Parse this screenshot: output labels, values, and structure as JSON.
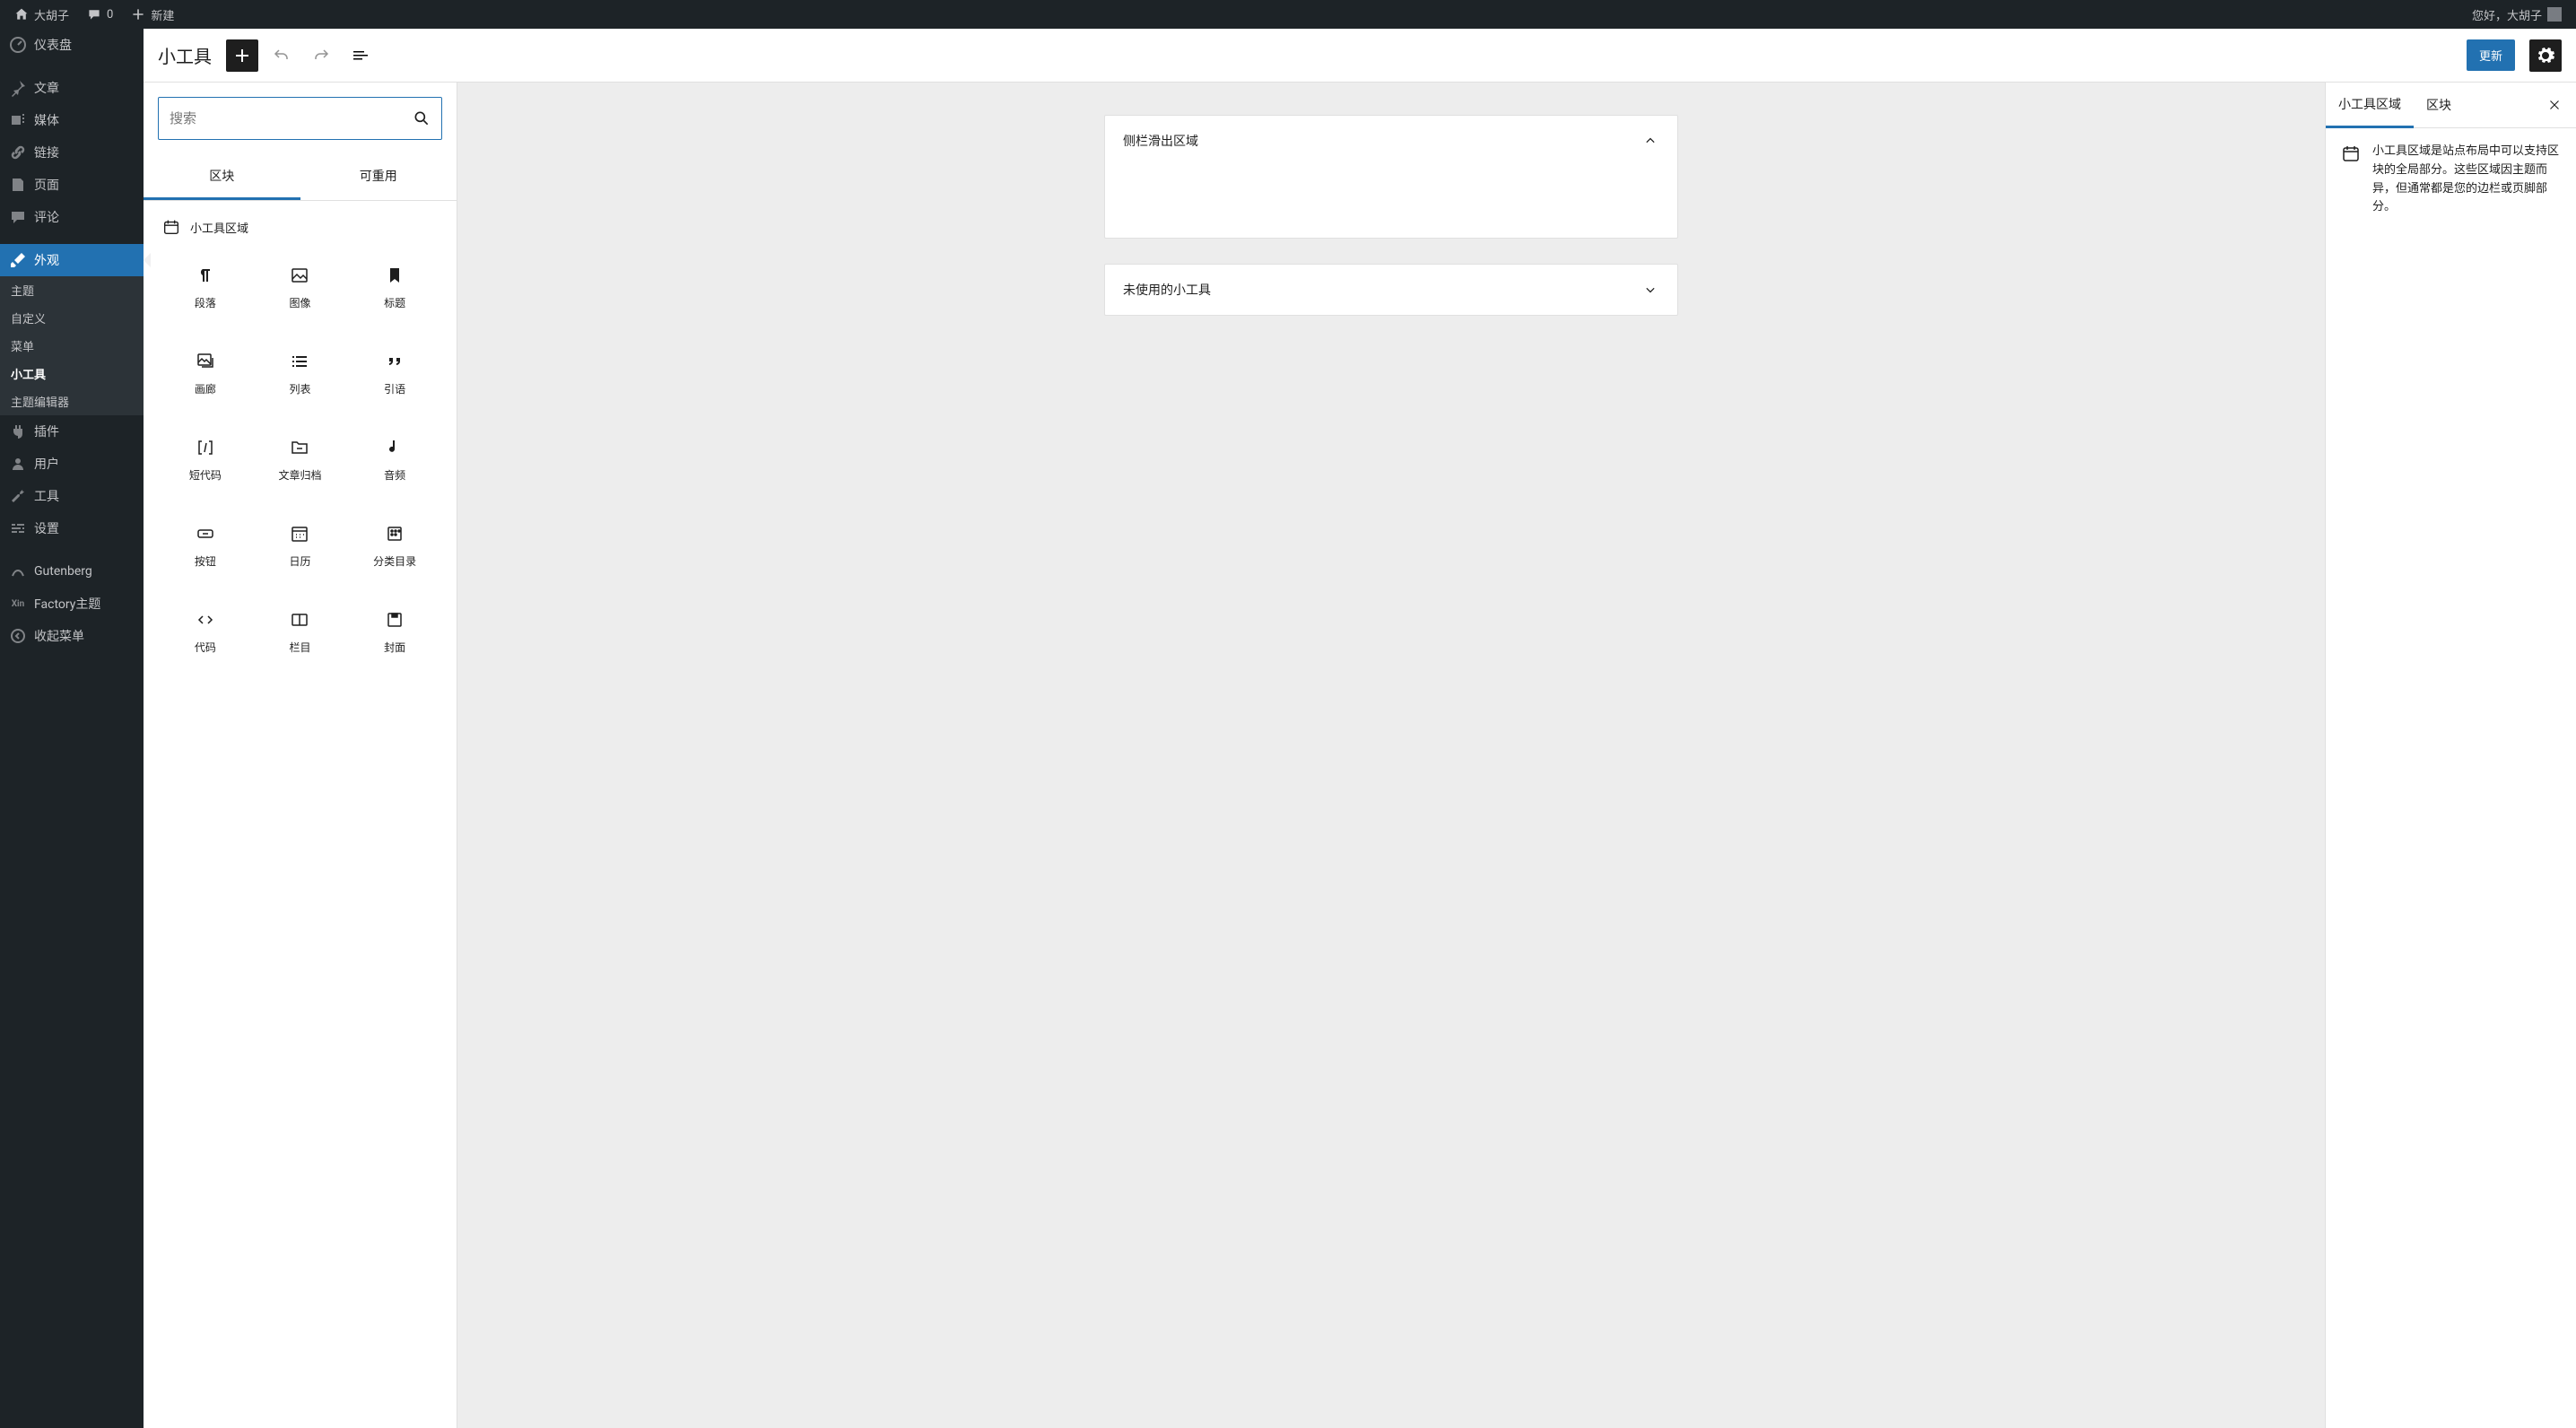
{
  "adminbar": {
    "site_name": "大胡子",
    "comments_count": "0",
    "new_label": "新建",
    "greeting": "您好，大胡子"
  },
  "sidebar": {
    "items": [
      {
        "id": "dashboard",
        "label": "仪表盘"
      },
      {
        "id": "posts",
        "label": "文章"
      },
      {
        "id": "media",
        "label": "媒体"
      },
      {
        "id": "links",
        "label": "链接"
      },
      {
        "id": "pages",
        "label": "页面"
      },
      {
        "id": "comments",
        "label": "评论"
      },
      {
        "id": "appearance",
        "label": "外观"
      },
      {
        "id": "plugins",
        "label": "插件"
      },
      {
        "id": "users",
        "label": "用户"
      },
      {
        "id": "tools",
        "label": "工具"
      },
      {
        "id": "settings",
        "label": "设置"
      },
      {
        "id": "gutenberg",
        "label": "Gutenberg"
      },
      {
        "id": "factory",
        "label": "Factory主题"
      },
      {
        "id": "collapse",
        "label": "收起菜单"
      }
    ],
    "appearance_sub": [
      {
        "id": "themes",
        "label": "主题"
      },
      {
        "id": "customize",
        "label": "自定义"
      },
      {
        "id": "menus",
        "label": "菜单"
      },
      {
        "id": "widgets",
        "label": "小工具"
      },
      {
        "id": "theme-editor",
        "label": "主题编辑器"
      }
    ]
  },
  "editor": {
    "title": "小工具",
    "update_label": "更新",
    "search_placeholder": "搜索",
    "tabs": {
      "blocks": "区块",
      "reusable": "可重用"
    },
    "section_widget_area": "小工具区域",
    "blocks": [
      {
        "id": "paragraph",
        "label": "段落"
      },
      {
        "id": "image",
        "label": "图像"
      },
      {
        "id": "heading",
        "label": "标题"
      },
      {
        "id": "gallery",
        "label": "画廊"
      },
      {
        "id": "list",
        "label": "列表"
      },
      {
        "id": "quote",
        "label": "引语"
      },
      {
        "id": "shortcode",
        "label": "短代码"
      },
      {
        "id": "archives",
        "label": "文章归档"
      },
      {
        "id": "audio",
        "label": "音频"
      },
      {
        "id": "button",
        "label": "按钮"
      },
      {
        "id": "calendar",
        "label": "日历"
      },
      {
        "id": "categories",
        "label": "分类目录"
      },
      {
        "id": "code",
        "label": "代码"
      },
      {
        "id": "columns",
        "label": "栏目"
      },
      {
        "id": "cover",
        "label": "封面"
      }
    ]
  },
  "canvas": {
    "areas": [
      {
        "id": "sidebar-slide",
        "title": "侧栏滑出区域",
        "expanded": true
      },
      {
        "id": "inactive",
        "title": "未使用的小工具",
        "expanded": false
      }
    ]
  },
  "rightbar": {
    "tabs": {
      "widget_area": "小工具区域",
      "block": "区块"
    },
    "description": "小工具区域是站点布局中可以支持区块的全局部分。这些区域因主题而异，但通常都是您的边栏或页脚部分。"
  }
}
